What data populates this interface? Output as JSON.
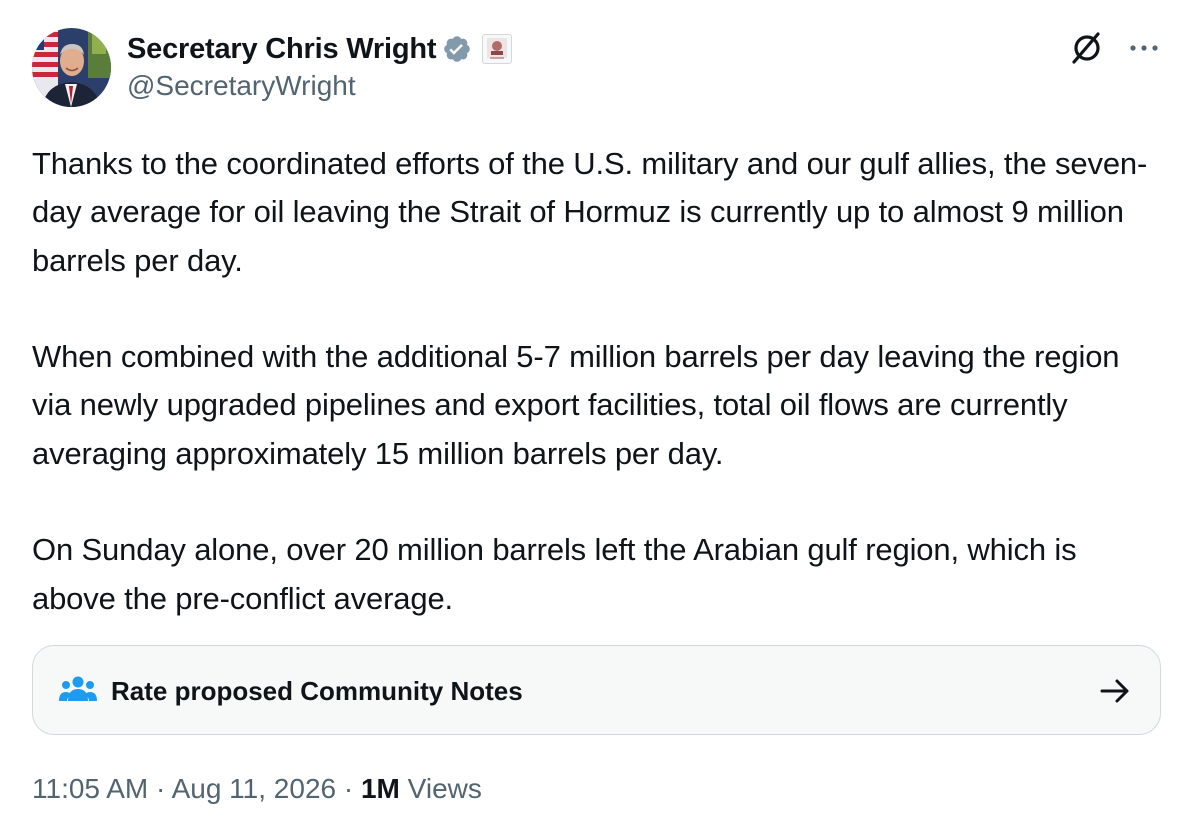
{
  "author": {
    "name": "Secretary Chris Wright",
    "handle": "@SecretaryWright",
    "verified": true,
    "verified_color": "#829aab"
  },
  "tweet": {
    "paragraphs": [
      "Thanks to the coordinated efforts of the U.S. military and our gulf allies, the seven-day average for oil leaving the Strait of Hormuz is currently up to almost 9 million barrels per day.",
      "When combined with the additional 5-7 million barrels per day leaving the region via newly upgraded pipelines and export facilities, total oil flows are currently averaging approximately 15 million barrels per day.",
      "On Sunday alone, over 20 million barrels left the Arabian gulf region, which is above the pre-conflict average."
    ]
  },
  "community_notes": {
    "label": "Rate proposed Community Notes",
    "icon": "people-icon",
    "icon_color": "#1d9bf0"
  },
  "meta": {
    "time": "11:05 AM",
    "separator": "·",
    "date": "Aug 11, 2026",
    "views_count": "1M",
    "views_label": "Views"
  },
  "icons": {
    "grok": "grok-slash-icon",
    "more": "more-dots-icon",
    "arrow": "arrow-right-icon"
  }
}
